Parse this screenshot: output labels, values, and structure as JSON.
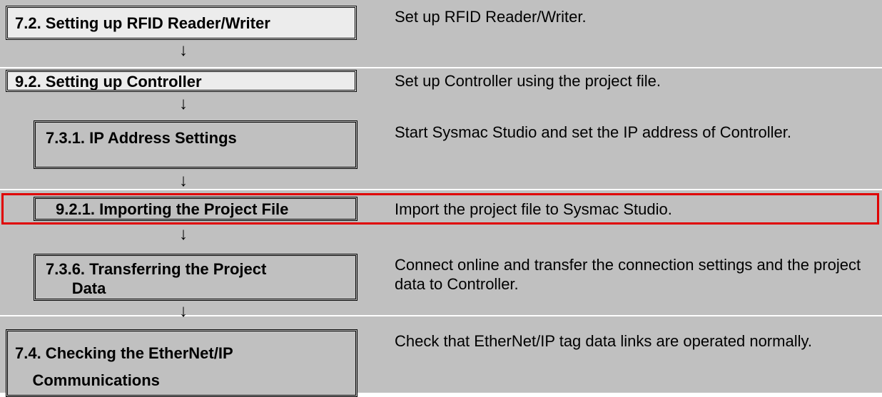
{
  "steps": [
    {
      "label": "7.2. Setting up RFID Reader/Writer",
      "desc": "Set up RFID Reader/Writer."
    },
    {
      "label": "9.2. Setting up Controller",
      "desc": "Set up Controller using the project file."
    },
    {
      "label": "7.3.1. IP Address Settings",
      "desc": "Start Sysmac Studio and set the IP address of Controller."
    },
    {
      "label": "9.2.1. Importing the Project File",
      "desc": "Import the project file to Sysmac Studio."
    },
    {
      "label": "7.3.6. Transferring the Project\n      Data",
      "desc": "Connect online and transfer the connection settings and the project data to Controller."
    },
    {
      "label": "7.4. Checking the EtherNet/IP\n    Communications",
      "desc": "Check that EtherNet/IP tag data links are operated normally."
    }
  ],
  "arrow_glyph": "↓",
  "highlight_color": "#e00000"
}
